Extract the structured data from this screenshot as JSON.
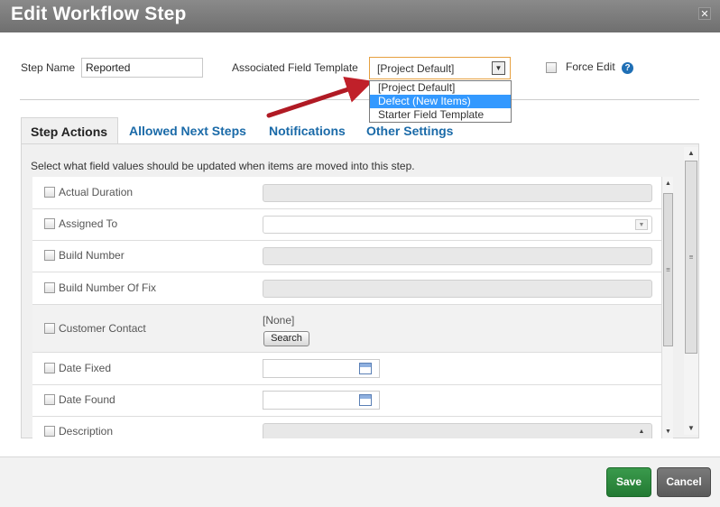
{
  "dialog": {
    "title": "Edit Workflow Step",
    "close_glyph": "✕"
  },
  "form": {
    "step_name_label": "Step Name",
    "step_name_value": "Reported",
    "template_label": "Associated Field Template",
    "template_selected": "[Project Default]",
    "template_options": [
      "[Project Default]",
      "Defect (New Items)",
      "Starter Field Template"
    ],
    "template_highlighted_index": 1,
    "force_edit_label": "Force Edit",
    "help_glyph": "?"
  },
  "tabs": [
    {
      "label": "Step Actions",
      "active": true
    },
    {
      "label": "Allowed Next Steps",
      "active": false
    },
    {
      "label": "Notifications",
      "active": false
    },
    {
      "label": "Other Settings",
      "active": false
    }
  ],
  "step_actions": {
    "description": "Select what field values should be updated when items are moved into this step.",
    "rows": [
      {
        "label": "Actual Duration",
        "kind": "text"
      },
      {
        "label": "Assigned To",
        "kind": "select"
      },
      {
        "label": "Build Number",
        "kind": "text"
      },
      {
        "label": "Build Number Of Fix",
        "kind": "text"
      },
      {
        "label": "Customer Contact",
        "kind": "search",
        "none_text": "[None]",
        "button": "Search"
      },
      {
        "label": "Date Fixed",
        "kind": "date"
      },
      {
        "label": "Date Found",
        "kind": "date"
      },
      {
        "label": "Description",
        "kind": "textarea"
      }
    ]
  },
  "footer": {
    "save_label": "Save",
    "cancel_label": "Cancel"
  },
  "colors": {
    "accent_link": "#1a6aa8",
    "save_green": "#2a8a3c",
    "cancel_gray": "#666666",
    "arrow_red": "#c0202a",
    "highlight_blue": "#3399ff"
  }
}
